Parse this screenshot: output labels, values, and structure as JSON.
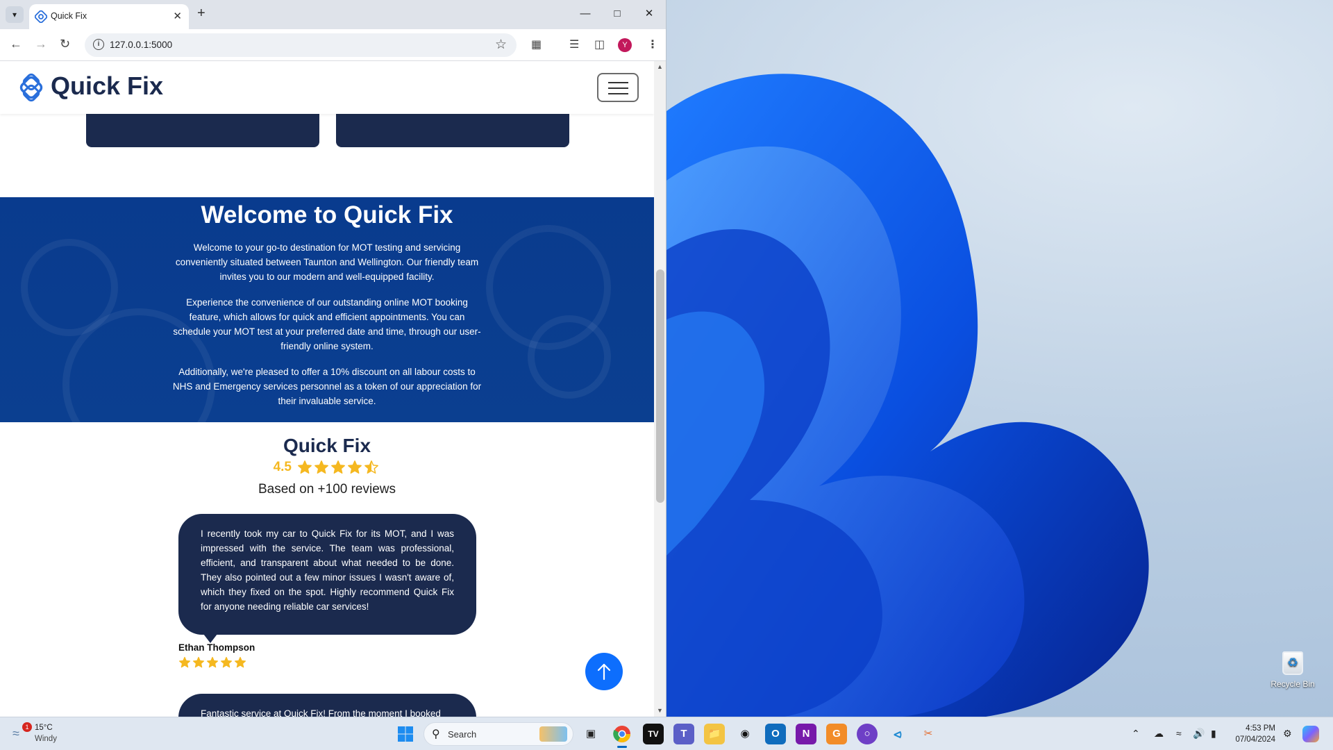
{
  "browser": {
    "tab_title": "Quick Fix",
    "new_tab": "+",
    "url": "127.0.0.1:5000",
    "profile_initial": "Y"
  },
  "site": {
    "logo_text": "Quick Fix",
    "hero": {
      "title": "Welcome to Quick Fix",
      "p1": "Welcome to your go-to destination for MOT testing and servicing conveniently situated between Taunton and Wellington. Our friendly team invites you to our modern and well-equipped facility.",
      "p2": "Experience the convenience of our outstanding online MOT booking feature, which allows for quick and efficient appointments. You can schedule your MOT test at your preferred date and time, through our user-friendly online system.",
      "p3": "Additionally, we're pleased to offer a 10% discount on all labour costs to NHS and Emergency services personnel as a token of our appreciation for their invaluable service."
    },
    "rating": {
      "title": "Quick Fix",
      "score": "4.5",
      "stars": 4.5,
      "based_on": "Based on +100 reviews"
    },
    "reviews": [
      {
        "text": "I recently took my car to Quick Fix for its MOT, and I was impressed with the service. The team was professional, efficient, and transparent about what needed to be done. They also pointed out a few minor issues I wasn't aware of, which they fixed on the spot. Highly recommend Quick Fix for anyone needing reliable car services!",
        "author": "Ethan Thompson",
        "stars": 5
      },
      {
        "text": "Fantastic service at Quick Fix! From the moment I booked"
      }
    ]
  },
  "taskbar": {
    "weather_temp": "15°C",
    "weather_desc": "Windy",
    "weather_badge": "1",
    "search_label": "Search",
    "time": "4:53 PM",
    "date": "07/04/2024"
  },
  "desktop": {
    "recycle_bin": "Recycle Bin"
  },
  "colors": {
    "brand_navy": "#1b2a4e",
    "hero_blue": "#0b3f90",
    "star_gold": "#f5b820",
    "scroll_top_blue": "#0d6efd"
  }
}
